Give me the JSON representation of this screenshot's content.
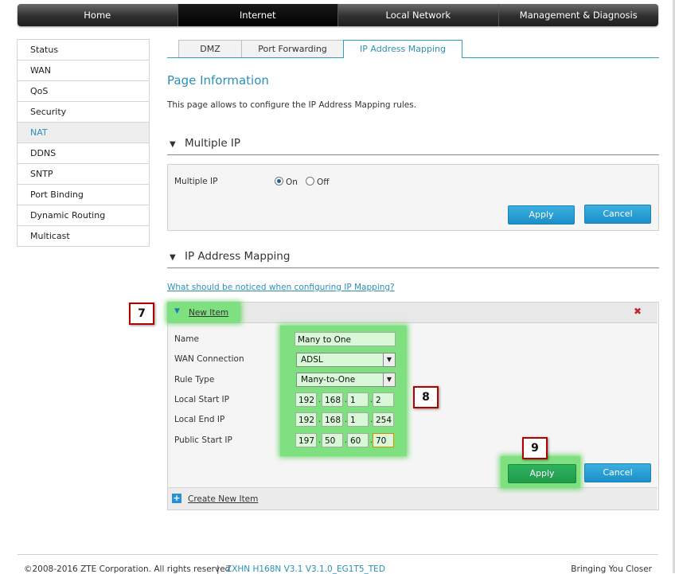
{
  "topnav": {
    "items": [
      {
        "label": "Home"
      },
      {
        "label": "Internet"
      },
      {
        "label": "Local Network"
      },
      {
        "label": "Management & Diagnosis"
      }
    ]
  },
  "sidebar": {
    "items": [
      {
        "label": "Status"
      },
      {
        "label": "WAN"
      },
      {
        "label": "QoS"
      },
      {
        "label": "Security"
      },
      {
        "label": "NAT"
      },
      {
        "label": "DDNS"
      },
      {
        "label": "SNTP"
      },
      {
        "label": "Port Binding"
      },
      {
        "label": "Dynamic Routing"
      },
      {
        "label": "Multicast"
      }
    ]
  },
  "tabs": [
    {
      "label": "DMZ"
    },
    {
      "label": "Port Forwarding"
    },
    {
      "label": "IP Address Mapping"
    }
  ],
  "page": {
    "title": "Page Information",
    "description": "This page allows to configure the IP Address Mapping rules."
  },
  "multiple_ip": {
    "section_title": "Multiple IP",
    "field_label": "Multiple IP",
    "on_label": "On",
    "off_label": "Off",
    "apply_label": "Apply",
    "cancel_label": "Cancel"
  },
  "mapping": {
    "section_title": "IP Address Mapping",
    "help_link": "What should be noticed when configuring IP Mapping?",
    "new_item_label": "New Item",
    "close_glyph": "✖",
    "labels": {
      "name": "Name",
      "wan": "WAN Connection",
      "rule_type": "Rule Type",
      "local_start": "Local Start IP",
      "local_end": "Local End IP",
      "public_start": "Public Start IP"
    },
    "values": {
      "name": "Many to One",
      "wan": "ADSL",
      "rule_type": "Many-to-One",
      "local_start": [
        "192",
        "168",
        "1",
        "2"
      ],
      "local_end": [
        "192",
        "168",
        "1",
        "254"
      ],
      "public_start": [
        "197",
        "50",
        "60",
        "70"
      ]
    },
    "apply_label": "Apply",
    "cancel_label": "Cancel",
    "create_new_label": "Create New Item",
    "plus_glyph": "+"
  },
  "callouts": [
    "7",
    "8",
    "9"
  ],
  "footer": {
    "copyright": "©2008-2016 ZTE Corporation. All rights reserved",
    "separator": "|",
    "version": "ZXHN H168N V3.1 V3.1.0_EG1T5_TED",
    "slogan": "Bringing You Closer"
  },
  "colors": {
    "accent": "#2d8fb5",
    "button_blue": "#1a8fc9",
    "button_green": "#1f9a4a",
    "highlight_green": "#7fe07f",
    "callout_border": "#b00000",
    "close_red": "#c0272d"
  }
}
